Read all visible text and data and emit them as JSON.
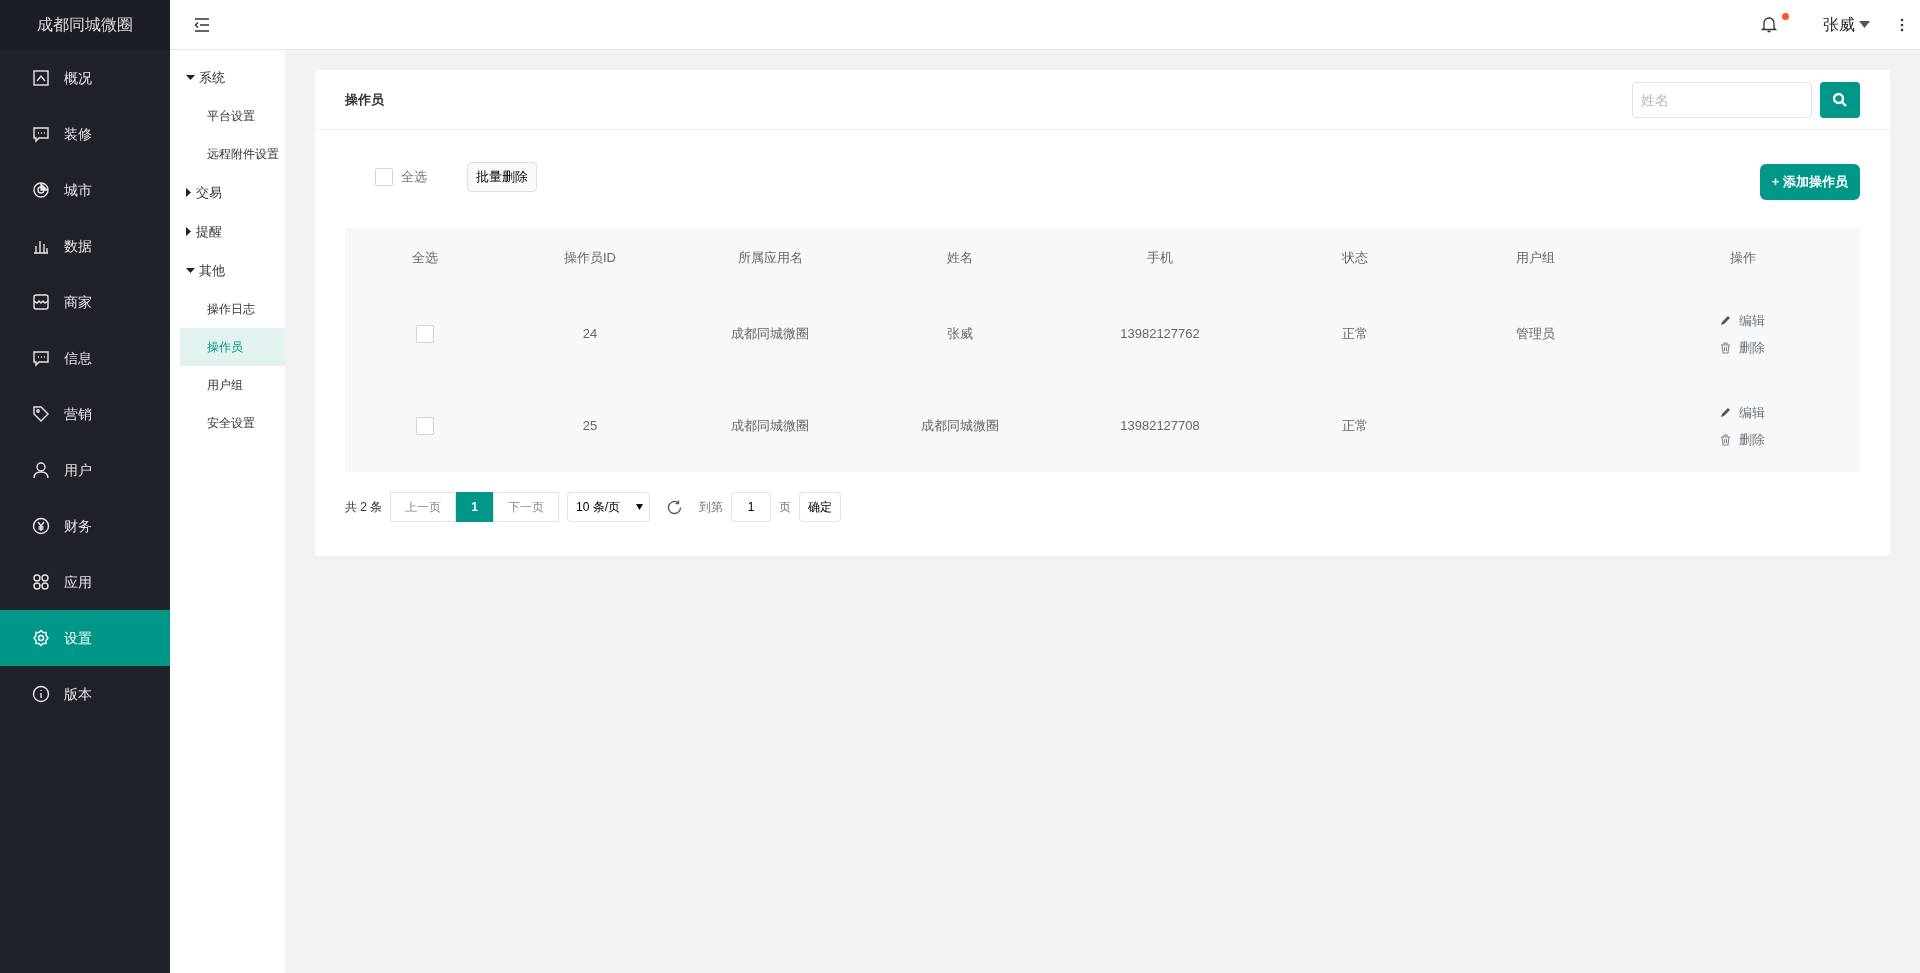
{
  "brand": "成都同城微圈",
  "nav": [
    {
      "label": "概况",
      "selected": false
    },
    {
      "label": "装修",
      "selected": false
    },
    {
      "label": "城市",
      "selected": false
    },
    {
      "label": "数据",
      "selected": false
    },
    {
      "label": "商家",
      "selected": false
    },
    {
      "label": "信息",
      "selected": false
    },
    {
      "label": "营销",
      "selected": false
    },
    {
      "label": "用户",
      "selected": false
    },
    {
      "label": "财务",
      "selected": false
    },
    {
      "label": "应用",
      "selected": false
    },
    {
      "label": "设置",
      "selected": true
    },
    {
      "label": "版本",
      "selected": false
    }
  ],
  "submenu": [
    {
      "label": "系统",
      "expanded": true,
      "children": [
        {
          "label": "平台设置",
          "selected": false
        },
        {
          "label": "远程附件设置",
          "selected": false
        }
      ]
    },
    {
      "label": "交易",
      "expanded": false
    },
    {
      "label": "提醒",
      "expanded": false
    },
    {
      "label": "其他",
      "expanded": true,
      "children": [
        {
          "label": "操作日志",
          "selected": false
        },
        {
          "label": "操作员",
          "selected": true
        },
        {
          "label": "用户组",
          "selected": false
        },
        {
          "label": "安全设置",
          "selected": false
        }
      ]
    }
  ],
  "header": {
    "user": "张威",
    "notification": true
  },
  "card": {
    "title": "操作员",
    "search": {
      "placeholder": "姓名"
    },
    "select_all": {
      "label": "全选",
      "checked": false
    },
    "batch_delete": "批量删除",
    "add_button": "+ 添加操作员",
    "table": {
      "columns": [
        "全选",
        "操作员ID",
        "所属应用名",
        "姓名",
        "手机",
        "状态",
        "用户组",
        "操作"
      ],
      "rows": [
        {
          "checked": false,
          "id": "24",
          "app": "成都同城微圈",
          "name": "张威",
          "phone": "13982127762",
          "status": "正常",
          "group": "管理员",
          "actions": [
            "编辑",
            "删除"
          ]
        },
        {
          "checked": false,
          "id": "25",
          "app": "成都同城微圈",
          "name": "成都同城微圈",
          "phone": "13982127708",
          "status": "正常",
          "actions": [
            "编辑",
            "删除"
          ]
        }
      ]
    },
    "pagination": {
      "total": "共 2 条",
      "prev": "上一页",
      "pages": [
        {
          "label": "1",
          "selected": true
        }
      ],
      "next": "下一页",
      "page_size": "10 条/页",
      "goto_label": "到第",
      "goto_value": "1",
      "page_unit": "页",
      "confirm": "确定"
    }
  }
}
